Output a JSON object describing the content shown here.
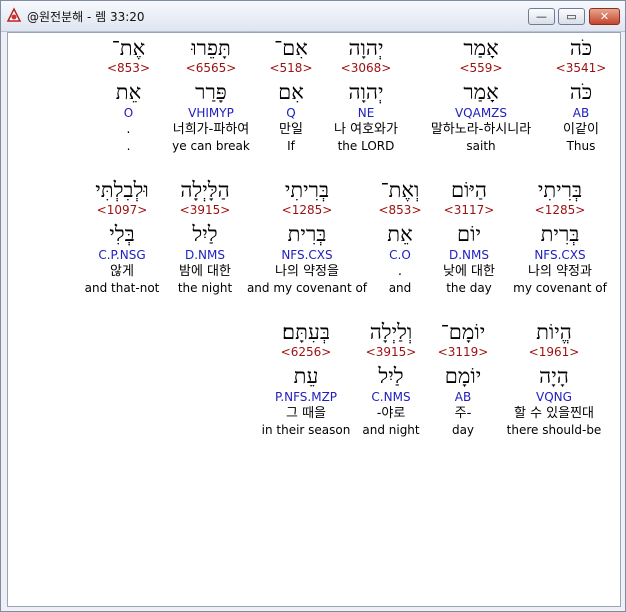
{
  "window": {
    "title": "@원전분해 - 렘 33:20",
    "buttons": {
      "minimize": "—",
      "maximize": "▭",
      "close": "✕"
    }
  },
  "rows": [
    [
      {
        "hebrew": "כֹּה",
        "strong": "<3541>",
        "lemma": "כֹּה",
        "morph": "AB",
        "korean": "이같이",
        "english": "Thus"
      },
      {
        "hebrew": "אָמַר",
        "strong": "<559>",
        "lemma": "אָמַר",
        "morph": "VQAMZS",
        "korean": "말하노라-하시니라",
        "english": "saith"
      },
      {
        "hebrew": "יְהוָה",
        "strong": "<3068>",
        "lemma": "יְהוָה",
        "morph": "NE",
        "korean": "나 여호와가",
        "english": "the LORD"
      },
      {
        "hebrew": "אִם־",
        "strong": "<518>",
        "lemma": "אִם",
        "morph": "Q",
        "korean": "만일",
        "english": "If"
      },
      {
        "hebrew": "תָּפֵרוּ",
        "strong": "<6565>",
        "lemma": "פָּרַר",
        "morph": "VHIMYP",
        "korean": "너희가-파하여",
        "english": "ye can break"
      },
      {
        "hebrew": "אֶת־",
        "strong": "<853>",
        "lemma": "אֵת",
        "morph": "O",
        "korean": ".",
        "english": "."
      }
    ],
    [
      {
        "hebrew": "בְּרִיתִי",
        "strong": "<1285>",
        "lemma": "בְּרִית",
        "morph": "NFS.CXS",
        "korean": "나의 약정과",
        "english": "my covenant of"
      },
      {
        "hebrew": "הַיּוֹם",
        "strong": "<3117>",
        "lemma": "יוֹם",
        "morph": "D.NMS",
        "korean": "낮에 대한",
        "english": "the day"
      },
      {
        "hebrew": "וְאֶת־",
        "strong": "<853>",
        "lemma": "אֵת",
        "morph": "C.O",
        "korean": ".",
        "english": "and"
      },
      {
        "hebrew": "בְּרִיתִי",
        "strong": "<1285>",
        "lemma": "בְּרִית",
        "morph": "NFS.CXS",
        "korean": "나의 약정을",
        "english": "and my covenant of"
      },
      {
        "hebrew": "הַלָּיְלָה",
        "strong": "<3915>",
        "lemma": "לַיִל",
        "morph": "D.NMS",
        "korean": "밤에 대한",
        "english": "the night"
      },
      {
        "hebrew": "וּלְבִלְתִּי",
        "strong": "<1097>",
        "lemma": "בְּלִי",
        "morph": "C.P.NSG",
        "korean": "않게",
        "english": "and that-not"
      }
    ],
    [
      {
        "hebrew": "הֱיוֹת",
        "strong": "<1961>",
        "lemma": "הָיָה",
        "morph": "VQNG",
        "korean": "할 수 있을찐대",
        "english": "there should-be"
      },
      {
        "hebrew": "יוֹמָם־",
        "strong": "<3119>",
        "lemma": "יוֹמָם",
        "morph": "AB",
        "korean": "주-",
        "english": "day"
      },
      {
        "hebrew": "וְלַיְלָה",
        "strong": "<3915>",
        "lemma": "לַיִל",
        "morph": "C.NMS",
        "korean": "-야로",
        "english": "and night"
      },
      {
        "hebrew": "בְּעִתָּם׃",
        "strong": "<6256>",
        "lemma": "עֵת",
        "morph": "P.NFS.MZP",
        "korean": "그 때을",
        "english": "in their season"
      }
    ]
  ]
}
